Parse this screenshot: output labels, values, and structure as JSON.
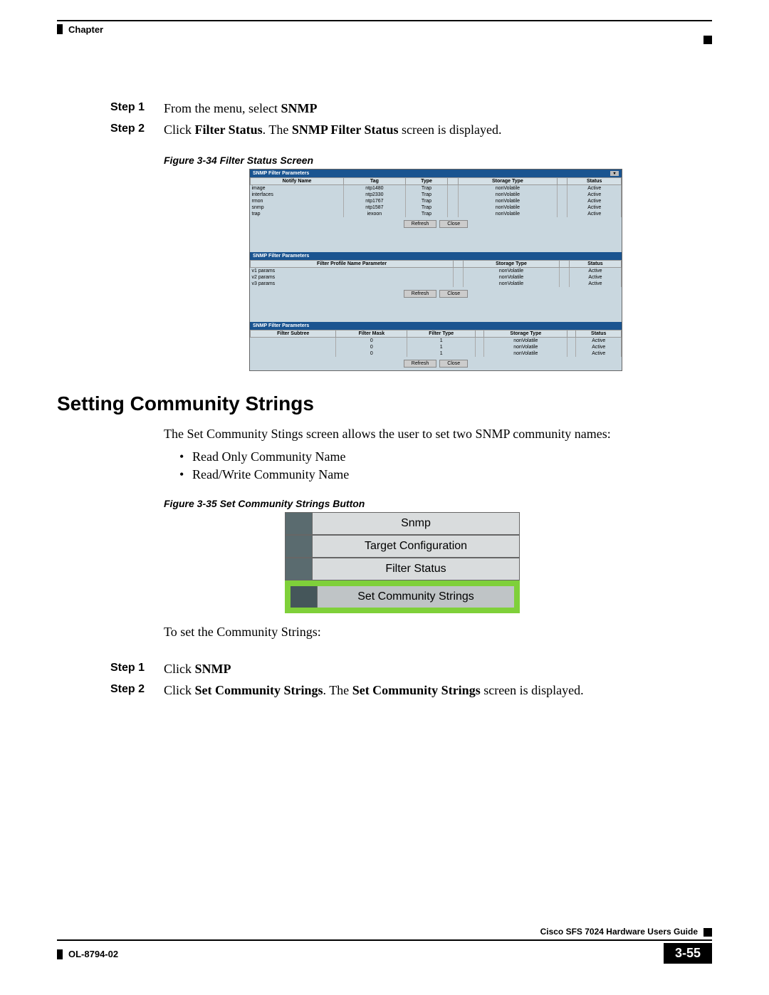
{
  "header": {
    "chapter": "Chapter"
  },
  "steps_a": [
    {
      "label": "Step 1",
      "pre": "From the menu, select ",
      "b1": "SNMP",
      "post": ""
    },
    {
      "label": "Step 2",
      "pre": "Click ",
      "b1": "Filter Status",
      "mid": ". The ",
      "b2": "SNMP Filter Status",
      "post": " screen is displayed."
    }
  ],
  "fig34": {
    "caption": "Figure 3-34   Filter Status Screen"
  },
  "fss": {
    "panel1_title": "SNMP Filter Parameters",
    "h1": [
      "Notify Name",
      "Tag",
      "Type",
      "",
      "Storage Type",
      "",
      "Status"
    ],
    "rows1": [
      [
        "image",
        "ntp1480",
        "Trap",
        "",
        "nonVolatile",
        "",
        "Active"
      ],
      [
        "interfaces",
        "ntp2330",
        "Trap",
        "",
        "nonVolatile",
        "",
        "Active"
      ],
      [
        "rmon",
        "ntp1767",
        "Trap",
        "",
        "nonVolatile",
        "",
        "Active"
      ],
      [
        "snmp",
        "ntp1587",
        "Trap",
        "",
        "nonVolatile",
        "",
        "Active"
      ],
      [
        "trap",
        "iexoon",
        "Trap",
        "",
        "nonVolatile",
        "",
        "Active"
      ]
    ],
    "btns": [
      "Refresh",
      "Close"
    ],
    "panel2_title": "SNMP Filter Parameters",
    "h2": [
      "Filter Profile Name Parameter",
      "",
      "Storage Type",
      "",
      "Status"
    ],
    "rows2": [
      [
        "v1 params",
        "",
        "nonVolatile",
        "",
        "Active"
      ],
      [
        "v2 params",
        "",
        "nonVolatile",
        "",
        "Active"
      ],
      [
        "v3 params",
        "",
        "nonVolatile",
        "",
        "Active"
      ]
    ],
    "panel3_title": "SNMP Filter Parameters",
    "h3": [
      "Filter Subtree",
      "Filter Mask",
      "Filter Type",
      "",
      "Storage Type",
      "",
      "Status"
    ],
    "rows3": [
      [
        "",
        "0",
        "1",
        "",
        "nonVolatile",
        "",
        "Active"
      ],
      [
        "",
        "0",
        "1",
        "",
        "nonVolatile",
        "",
        "Active"
      ],
      [
        "",
        "0",
        "1",
        "",
        "nonVolatile",
        "",
        "Active"
      ]
    ]
  },
  "section": {
    "heading": "Setting Community Strings",
    "intro": "The Set Community Stings screen allows the user to set two SNMP community names:",
    "bullets": [
      "Read Only Community Name",
      "Read/Write Community Name"
    ]
  },
  "fig35": {
    "caption": "Figure 3-35   Set Community Strings Button"
  },
  "menu": {
    "items": [
      "Snmp",
      "Target Configuration",
      "Filter Status",
      "Set Community Strings"
    ],
    "highlight_index": 3
  },
  "lead_in": "To set the Community Strings:",
  "steps_b": [
    {
      "label": "Step 1",
      "pre": "Click ",
      "b1": "SNMP",
      "post": ""
    },
    {
      "label": "Step 2",
      "pre": "Click ",
      "b1": "Set Community Strings",
      "mid": ". The ",
      "b2": "Set Community Strings",
      "post": " screen is displayed."
    }
  ],
  "footer": {
    "guide": "Cisco SFS 7024 Hardware Users Guide",
    "ol": "OL-8794-02",
    "page": "3-55"
  }
}
